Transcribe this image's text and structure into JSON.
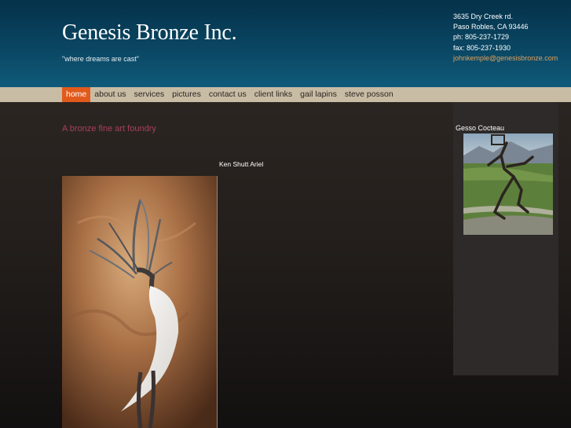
{
  "header": {
    "title": "Genesis Bronze Inc.",
    "tagline": "\"where dreams are cast\"",
    "contact": {
      "address1": "3635 Dry Creek rd.",
      "address2": "Paso Robles, CA 93446",
      "phone": "ph: 805-237-1729",
      "fax": "fax: 805-237-1930",
      "email": "johnkemple@genesisbronze.com"
    }
  },
  "nav": {
    "items": [
      {
        "label": "home",
        "active": true
      },
      {
        "label": "about us"
      },
      {
        "label": "services"
      },
      {
        "label": "pictures"
      },
      {
        "label": "contact us"
      },
      {
        "label": "client links"
      },
      {
        "label": "gail lapins"
      },
      {
        "label": "steve posson"
      }
    ]
  },
  "main": {
    "intro": "A bronze fine art foundry",
    "caption": "Ken Shutt  Ariel"
  },
  "sidebar": {
    "title": "Gesso Cocteau"
  },
  "colors": {
    "header_bg": "#0a4662",
    "nav_bg": "#c8bca5",
    "nav_active": "#e15a1c",
    "intro_text": "#a8405e",
    "email_link": "#e0a05a"
  }
}
